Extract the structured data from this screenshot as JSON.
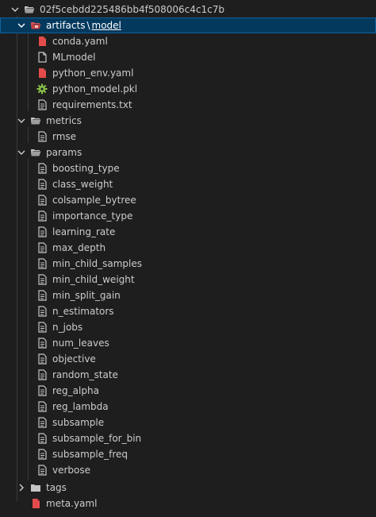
{
  "root": {
    "label": "02f5cebdd225486bb4f508006c4c1c7b",
    "icon": "folder-open-icon"
  },
  "artifacts": {
    "label_part1": "artifacts",
    "separator": "\\",
    "label_part2": "model",
    "icon": "folder-open-icon",
    "files": [
      {
        "label": "conda.yaml",
        "icon": "file-yaml-icon",
        "color": "#e44c4c"
      },
      {
        "label": "MLmodel",
        "icon": "file-icon",
        "color": "#cccccc"
      },
      {
        "label": "python_env.yaml",
        "icon": "file-yaml-icon",
        "color": "#e44c4c"
      },
      {
        "label": "python_model.pkl",
        "icon": "gear-icon",
        "color": "#8bc34a"
      },
      {
        "label": "requirements.txt",
        "icon": "file-text-icon",
        "color": "#cccccc"
      }
    ]
  },
  "metrics": {
    "label": "metrics",
    "icon": "folder-open-icon",
    "files": [
      "rmse"
    ]
  },
  "params": {
    "label": "params",
    "icon": "folder-open-icon",
    "files": [
      "boosting_type",
      "class_weight",
      "colsample_bytree",
      "importance_type",
      "learning_rate",
      "max_depth",
      "min_child_samples",
      "min_child_weight",
      "min_split_gain",
      "n_estimators",
      "n_jobs",
      "num_leaves",
      "objective",
      "random_state",
      "reg_alpha",
      "reg_lambda",
      "subsample",
      "subsample_for_bin",
      "subsample_freq",
      "verbose"
    ]
  },
  "tags": {
    "label": "tags",
    "icon": "folder-icon"
  },
  "meta": {
    "label": "meta.yaml",
    "icon": "file-yaml-icon",
    "color": "#e44c4c"
  },
  "colors": {
    "background": "#1e1e1e",
    "selected": "#04395e",
    "text": "#cccccc"
  }
}
